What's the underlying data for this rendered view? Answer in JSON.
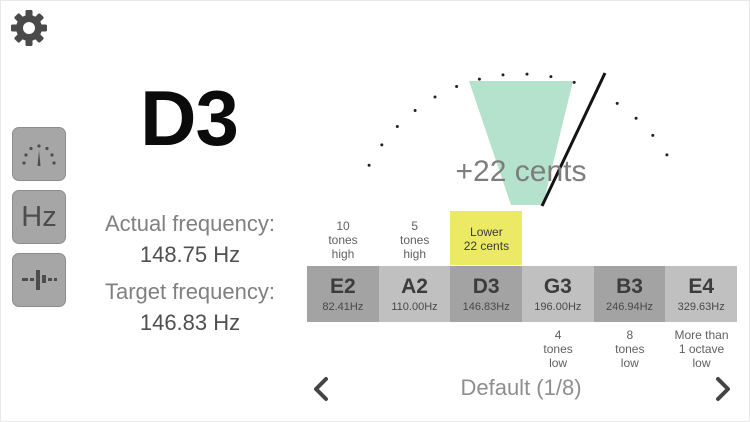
{
  "app": {
    "current_note": "D3",
    "colors": {
      "selected_hint": "#ecea64",
      "tolerance_zone": "#b4e2cc",
      "needle": "#141414"
    }
  },
  "toolbar": {
    "settings_icon": "gear-icon",
    "modes": [
      {
        "id": "meter",
        "icon": "gauge-icon"
      },
      {
        "id": "hz",
        "label": "Hz"
      },
      {
        "id": "strobe",
        "icon": "strobe-icon"
      }
    ]
  },
  "readout": {
    "actual_label": "Actual frequency:",
    "actual_value": "148.75 Hz",
    "target_label": "Target frequency:",
    "target_value": "146.83 Hz"
  },
  "meter": {
    "cents_text": "+22 cents",
    "cents_value": 22
  },
  "strings": [
    {
      "name": "E2",
      "freq": "82.41Hz",
      "hint": "10\ntones\nhigh",
      "hint_pos": "above",
      "bg": "#a3a3a3"
    },
    {
      "name": "A2",
      "freq": "110.00Hz",
      "hint": "5\ntones\nhigh",
      "hint_pos": "above",
      "bg": "#c0c0c0"
    },
    {
      "name": "D3",
      "freq": "146.83Hz",
      "hint": "Lower\n22 cents",
      "hint_pos": "above",
      "bg": "#a3a3a3",
      "selected": true
    },
    {
      "name": "G3",
      "freq": "196.00Hz",
      "hint": "4\ntones\nlow",
      "hint_pos": "below",
      "bg": "#c0c0c0"
    },
    {
      "name": "B3",
      "freq": "246.94Hz",
      "hint": "8\ntones\nlow",
      "hint_pos": "below",
      "bg": "#a3a3a3"
    },
    {
      "name": "E4",
      "freq": "329.63Hz",
      "hint": "More than\n1 octave\nlow",
      "hint_pos": "below",
      "bg": "#c0c0c0"
    }
  ],
  "footer": {
    "preset_label": "Default (1/8)",
    "prev_icon": "chevron-left-icon",
    "next_icon": "chevron-right-icon"
  }
}
